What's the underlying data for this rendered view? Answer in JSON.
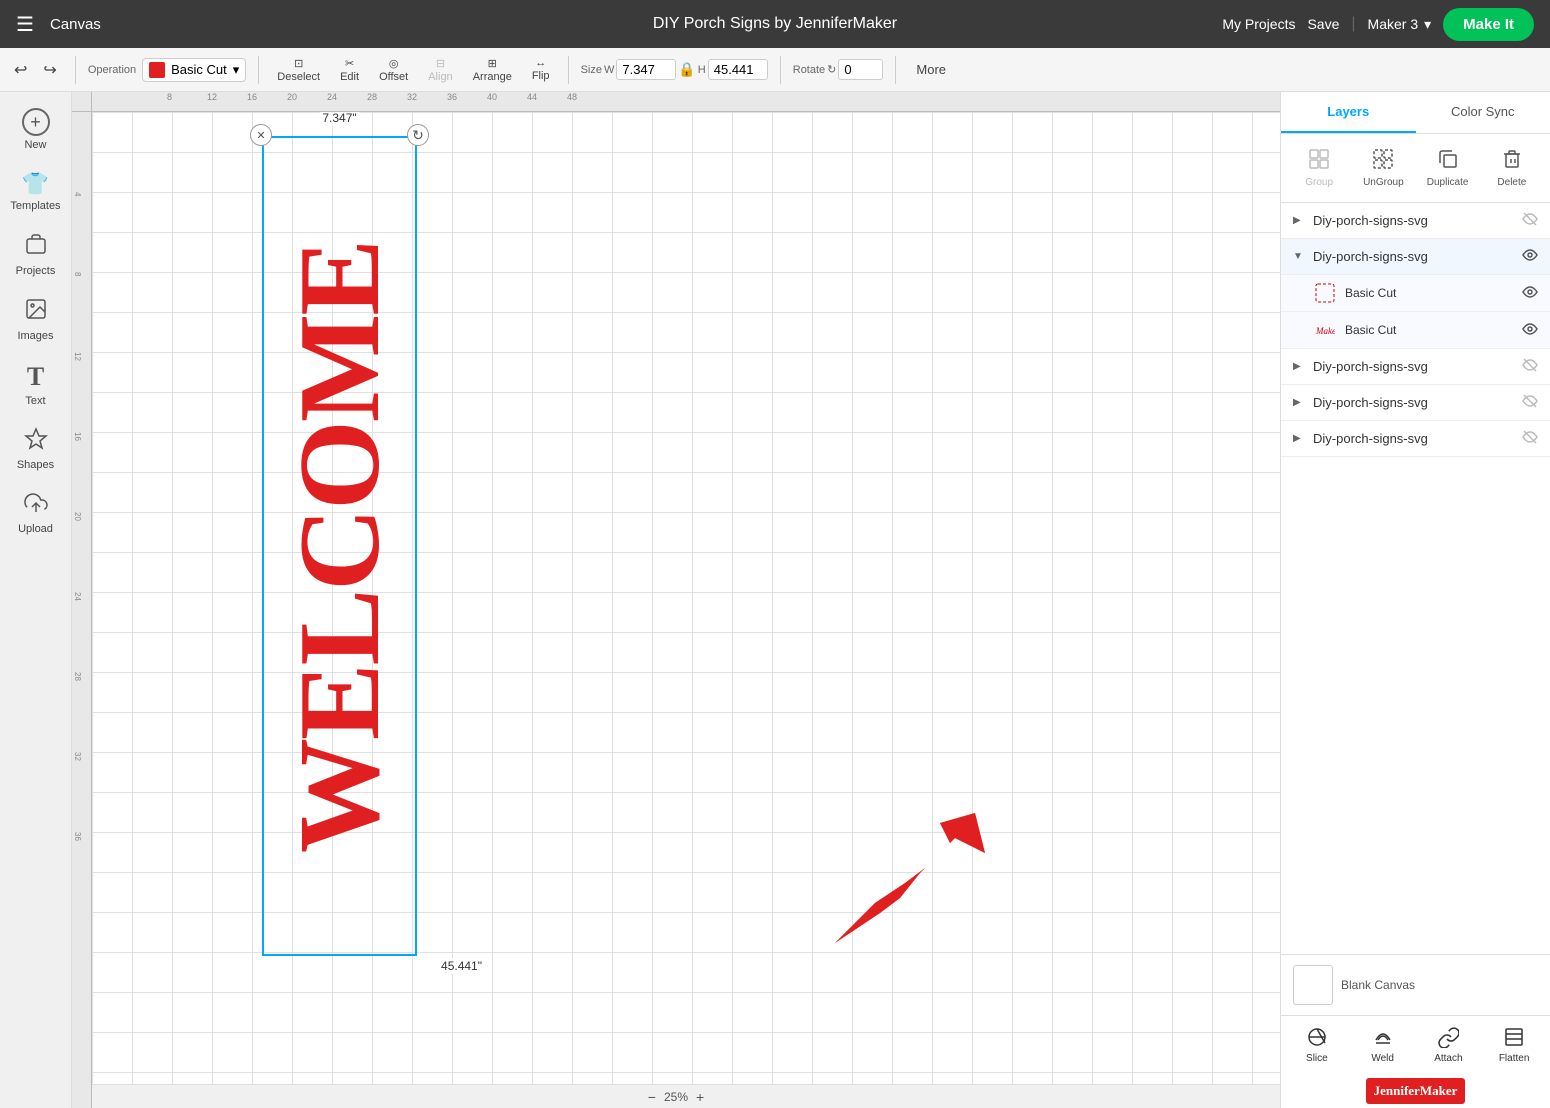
{
  "topbar": {
    "menu_icon": "☰",
    "canvas_label": "Canvas",
    "title": "DIY Porch Signs by JenniferMaker",
    "my_projects": "My Projects",
    "save": "Save",
    "machine": "Maker 3",
    "make_it": "Make It"
  },
  "toolbar": {
    "undo_icon": "↩",
    "redo_icon": "↪",
    "operation_label": "Operation",
    "operation_value": "Basic Cut",
    "deselect_label": "Deselect",
    "edit_label": "Edit",
    "offset_label": "Offset",
    "align_label": "Align",
    "arrange_label": "Arrange",
    "flip_label": "Flip",
    "size_label": "Size",
    "width_label": "W",
    "width_value": "7.347",
    "height_label": "H",
    "height_value": "45.441",
    "rotate_label": "Rotate",
    "rotate_value": "0",
    "more_label": "More"
  },
  "sidebar": {
    "items": [
      {
        "id": "new",
        "icon": "+",
        "label": "New"
      },
      {
        "id": "templates",
        "icon": "👕",
        "label": "Templates"
      },
      {
        "id": "projects",
        "icon": "📁",
        "label": "Projects"
      },
      {
        "id": "images",
        "icon": "🖼",
        "label": "Images"
      },
      {
        "id": "text",
        "icon": "T",
        "label": "Text"
      },
      {
        "id": "shapes",
        "icon": "⬡",
        "label": "Shapes"
      },
      {
        "id": "upload",
        "icon": "⬆",
        "label": "Upload"
      }
    ]
  },
  "canvas": {
    "welcome_text": "WELCOME",
    "dimension_w": "7.347\"",
    "dimension_h": "45.441\"",
    "zoom": "25%",
    "selection_close": "✕",
    "selection_rotate": "↻"
  },
  "right_panel": {
    "tabs": [
      {
        "id": "layers",
        "label": "Layers"
      },
      {
        "id": "color_sync",
        "label": "Color Sync"
      }
    ],
    "actions": [
      {
        "id": "group",
        "icon": "⊞",
        "label": "Group",
        "disabled": true
      },
      {
        "id": "ungroup",
        "icon": "⊟",
        "label": "UnGroup",
        "disabled": false
      },
      {
        "id": "duplicate",
        "icon": "❐",
        "label": "Duplicate",
        "disabled": false
      },
      {
        "id": "delete",
        "icon": "🗑",
        "label": "Delete",
        "disabled": false
      }
    ],
    "layers": [
      {
        "id": "layer1",
        "name": "Diy-porch-signs-svg",
        "expanded": false,
        "visible": false,
        "children": []
      },
      {
        "id": "layer2",
        "name": "Diy-porch-signs-svg",
        "expanded": true,
        "visible": true,
        "children": [
          {
            "id": "sub1",
            "name": "Basic Cut",
            "type": "dashed",
            "visible": true
          },
          {
            "id": "sub2",
            "name": "Basic Cut",
            "type": "makers",
            "visible": true
          }
        ]
      },
      {
        "id": "layer3",
        "name": "Diy-porch-signs-svg",
        "expanded": false,
        "visible": false,
        "children": []
      },
      {
        "id": "layer4",
        "name": "Diy-porch-signs-svg",
        "expanded": false,
        "visible": false,
        "children": []
      },
      {
        "id": "layer5",
        "name": "Diy-porch-signs-svg",
        "expanded": false,
        "visible": false,
        "children": []
      }
    ],
    "blank_canvas_label": "Blank Canvas"
  },
  "footer": {
    "slice": "Slice",
    "weld": "Weld",
    "attach": "Attach",
    "flatten": "Flatten"
  }
}
